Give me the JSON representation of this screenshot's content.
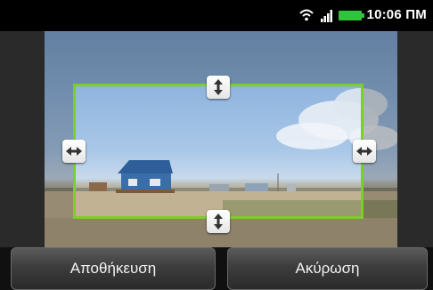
{
  "status_bar": {
    "time": "10:06 ΠΜ",
    "icons": [
      "wifi-icon",
      "signal-icon",
      "battery-icon"
    ],
    "battery_color": "#30c43a"
  },
  "crop": {
    "frame_color": "#7ccf2b",
    "handles": [
      "resize-vertical-icon",
      "resize-horizontal-icon"
    ]
  },
  "buttons": {
    "save_label": "Αποθήκευση",
    "cancel_label": "Ακύρωση"
  }
}
